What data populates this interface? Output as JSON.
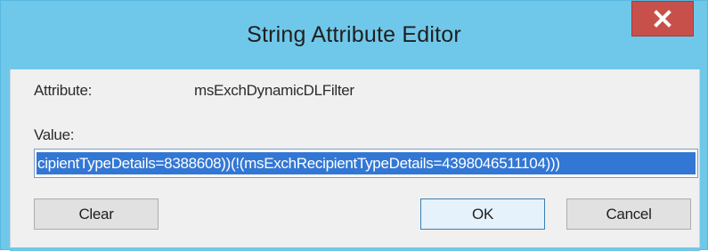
{
  "window": {
    "title": "String Attribute Editor",
    "close_icon": "close-x-icon",
    "titlebar_color": "#6fc8ea",
    "close_color": "#c7504a"
  },
  "form": {
    "attribute_label": "Attribute:",
    "attribute_value": "msExchDynamicDLFilter",
    "value_label": "Value:",
    "value_text": "cipientTypeDetails=8388608))(!(msExchRecipientTypeDetails=4398046511104)))",
    "selection_color": "#3377d4"
  },
  "buttons": {
    "clear": "Clear",
    "ok": "OK",
    "cancel": "Cancel"
  }
}
